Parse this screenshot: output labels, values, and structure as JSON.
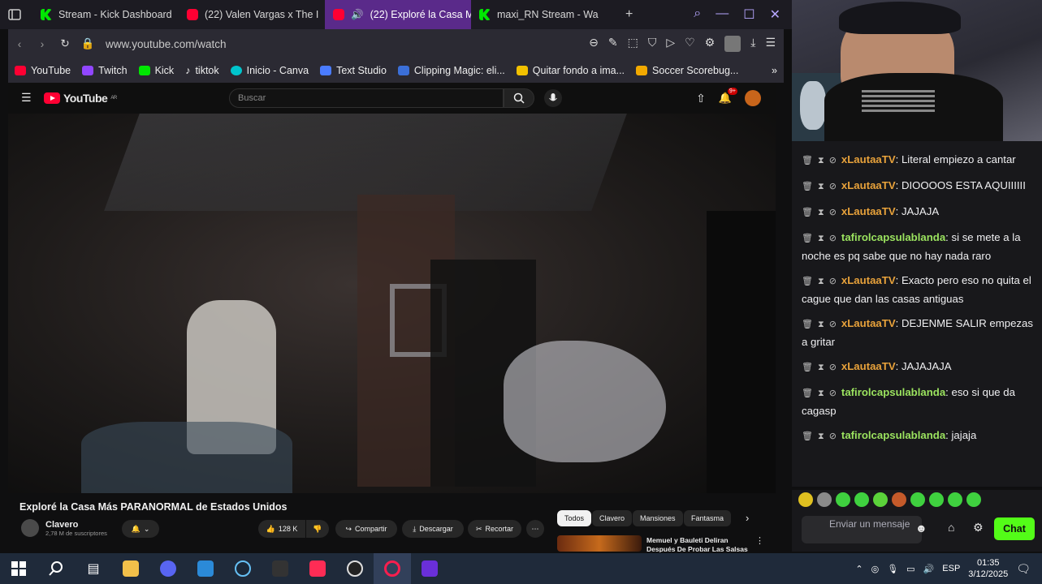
{
  "browser": {
    "tabs": [
      {
        "title": "Stream - Kick Dashboard",
        "icon": "kick-icon"
      },
      {
        "title": "(22) Valen Vargas x The I",
        "icon": "youtube-icon"
      },
      {
        "title": "(22) Exploré la Casa M",
        "icon": "youtube-icon",
        "active": true
      },
      {
        "title": "maxi_RN Stream - Wa",
        "icon": "kick-icon"
      }
    ],
    "new_tab": "+",
    "url": "www.youtube.com/watch"
  },
  "bookmarks": [
    {
      "label": "YouTube",
      "color": "#ff0033"
    },
    {
      "label": "Twitch",
      "color": "#9146ff"
    },
    {
      "label": "Kick",
      "color": "#00e701"
    },
    {
      "label": "tiktok",
      "color": "#ffffff"
    },
    {
      "label": "Inicio - Canva",
      "color": "#00c4cc"
    },
    {
      "label": "Text Studio",
      "color": "#4a7cff"
    },
    {
      "label": "Clipping Magic: eli...",
      "color": "#3b6fd8"
    },
    {
      "label": "Quitar fondo a ima...",
      "color": "#f2c100"
    },
    {
      "label": "Soccer Scorebug...",
      "color": "#f2a900"
    }
  ],
  "youtube": {
    "logo": "YouTube",
    "logo_region": "AR",
    "search_placeholder": "Buscar",
    "notification_count": "9+",
    "video_title": "Exploré la Casa Más PARANORMAL de Estados Unidos",
    "channel_name": "Clavero",
    "channel_subs": "2,78 M de suscriptores",
    "likes": "128 K",
    "share": "Compartir",
    "download": "Descargar",
    "clip": "Recortar",
    "chips": [
      "Todos",
      "Clavero",
      "Mansiones",
      "Fantasma"
    ],
    "recommended_title": "Memuel y Bauleti Deliran Después De Probar Las Salsas"
  },
  "chat": {
    "messages": [
      {
        "user": "xLautaaTV",
        "color": "o",
        "text": "Literal empiezo a cantar"
      },
      {
        "user": "xLautaaTV",
        "color": "o",
        "text": "DIOOOOS ESTA AQUIIIIII"
      },
      {
        "user": "xLautaaTV",
        "color": "o",
        "text": "JAJAJA"
      },
      {
        "user": "tafirolcapsulablanda",
        "color": "g",
        "text": "si se mete a la noche es pq sabe que no hay nada raro"
      },
      {
        "user": "xLautaaTV",
        "color": "o",
        "text": "Exacto pero eso no quita el cague que dan las casas antiguas"
      },
      {
        "user": "xLautaaTV",
        "color": "o",
        "text": "DEJENME SALIR empezas a gritar"
      },
      {
        "user": "xLautaaTV",
        "color": "o",
        "text": "JAJAJAJA"
      },
      {
        "user": "tafirolcapsulablanda",
        "color": "g",
        "text": "eso si que da cagasp"
      },
      {
        "user": "tafirolcapsulablanda",
        "color": "g",
        "text": "jajaja"
      }
    ],
    "input_placeholder": "Enviar un mensaje",
    "send_label": "Chat"
  },
  "taskbar": {
    "lang": "ESP",
    "time": "01:35",
    "date": "3/12/2025"
  }
}
